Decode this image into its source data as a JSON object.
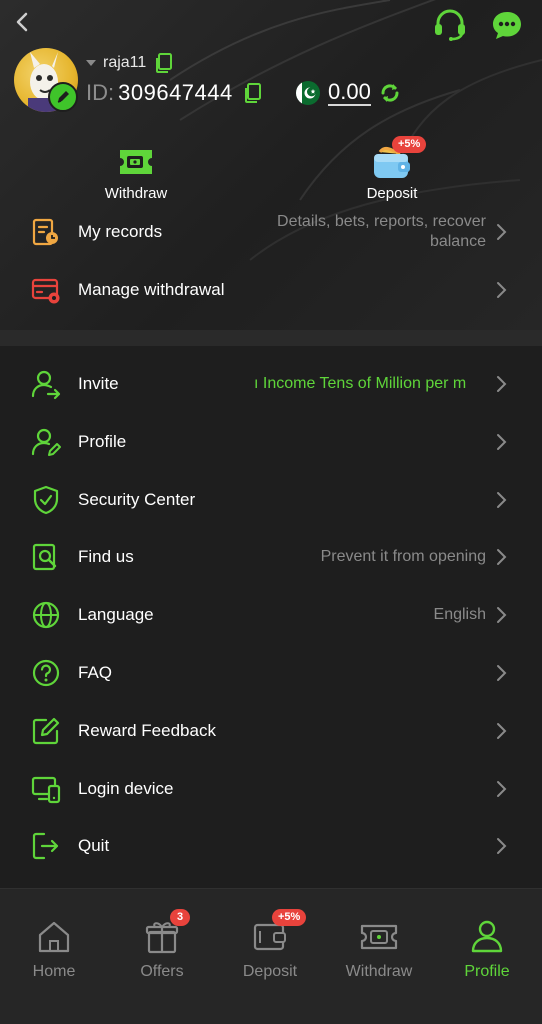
{
  "header": {
    "username": "raja11",
    "id_label": "ID:",
    "id_value": "309647444",
    "balance": "0.00"
  },
  "quick_actions": {
    "withdraw_label": "Withdraw",
    "deposit_label": "Deposit",
    "deposit_badge": "+5%"
  },
  "menu": {
    "records": {
      "label": "My records",
      "desc_line1": "Details, bets, reports, recover",
      "desc_line2": "balance"
    },
    "manage_withdrawal": {
      "label": "Manage withdrawal"
    },
    "invite": {
      "label": "Invite",
      "desc": "ı Income Tens of Million per m"
    },
    "profile": {
      "label": "Profile"
    },
    "security": {
      "label": "Security Center"
    },
    "find_us": {
      "label": "Find us",
      "desc": "Prevent it from opening"
    },
    "language": {
      "label": "Language",
      "desc": "English"
    },
    "faq": {
      "label": "FAQ"
    },
    "reward_feedback": {
      "label": "Reward Feedback"
    },
    "login_device": {
      "label": "Login device"
    },
    "quit": {
      "label": "Quit"
    }
  },
  "bottom_nav": {
    "home": "Home",
    "offers": "Offers",
    "offers_badge": "3",
    "deposit": "Deposit",
    "deposit_badge": "+5%",
    "withdraw": "Withdraw",
    "profile": "Profile",
    "active": "profile"
  },
  "icons": {
    "back": "chevron-left-icon",
    "support": "headset-icon",
    "chat": "chat-icon",
    "edit": "pencil-icon",
    "copy": "copy-icon",
    "flag": "pakistan-flag-icon",
    "refresh": "refresh-icon"
  },
  "colors": {
    "accent": "#5fd53a",
    "badge": "#e8433c",
    "background": "#1e1e1e",
    "muted_text": "#8a8a8a"
  }
}
